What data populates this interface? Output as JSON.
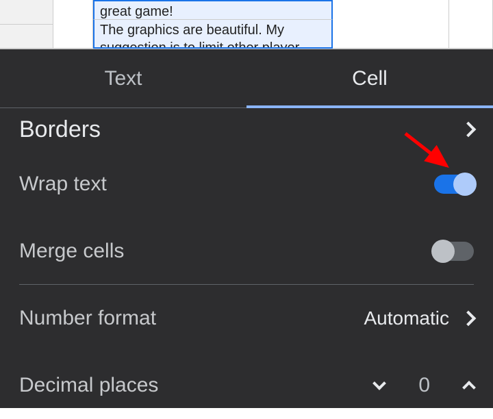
{
  "spreadsheet": {
    "cell_top_text": "great game!",
    "cell_bottom_text": "The graphics are beautiful. My suggestion is to limit other player"
  },
  "tabs": {
    "text": "Text",
    "cell": "Cell"
  },
  "settings": {
    "borders": {
      "label": "Borders"
    },
    "wrap_text": {
      "label": "Wrap text",
      "on": true
    },
    "merge_cells": {
      "label": "Merge cells",
      "on": false
    },
    "number_format": {
      "label": "Number format",
      "value": "Automatic"
    },
    "decimal_places": {
      "label": "Decimal places",
      "value": "0"
    }
  }
}
